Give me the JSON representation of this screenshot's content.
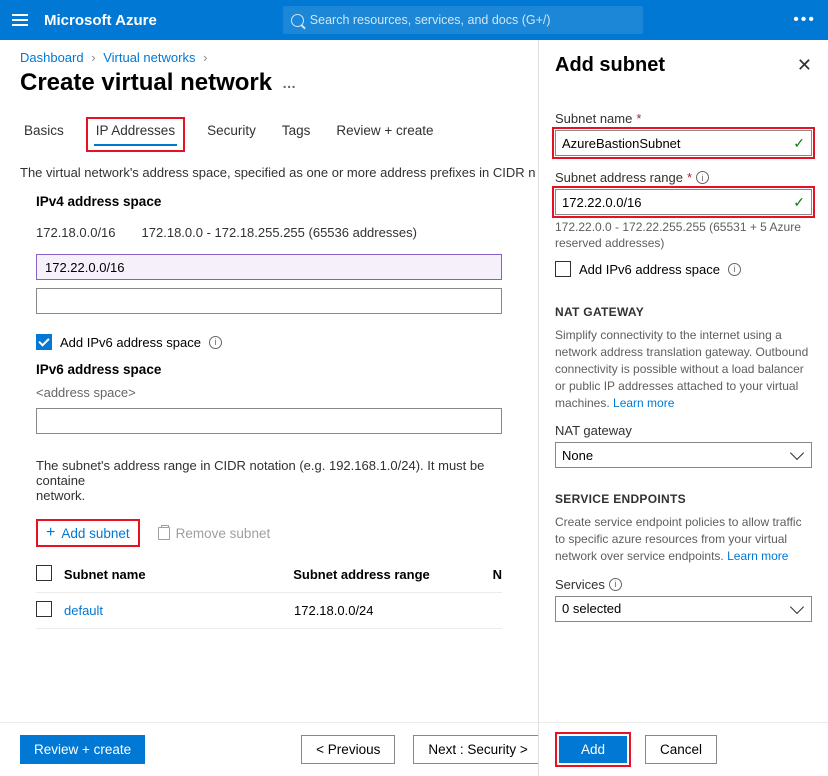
{
  "topbar": {
    "brand": "Microsoft Azure",
    "search_placeholder": "Search resources, services, and docs (G+/)"
  },
  "breadcrumbs": {
    "dashboard": "Dashboard",
    "vnets": "Virtual networks"
  },
  "page": {
    "title": "Create virtual network"
  },
  "tabs": {
    "basics": "Basics",
    "ip": "IP Addresses",
    "security": "Security",
    "tags": "Tags",
    "review": "Review + create"
  },
  "descriptions": {
    "ip_desc": "The virtual network's address space, specified as one or more address prefixes in CIDR n",
    "subnet_desc": "The subnet's address range in CIDR notation (e.g. 192.168.1.0/24). It must be containe",
    "subnet_desc2": "network."
  },
  "ipv4": {
    "header": "IPv4 address space",
    "existing_cidr": "172.18.0.0/16",
    "existing_range": "172.18.0.0 - 172.18.255.255 (65536 addresses)",
    "input_value": "172.22.0.0/16"
  },
  "ipv6": {
    "chk_label": "Add IPv6 address space",
    "header": "IPv6 address space",
    "placeholder": "<address space>"
  },
  "subnet_actions": {
    "add": "Add subnet",
    "remove": "Remove subnet"
  },
  "subnet_table": {
    "col_name": "Subnet name",
    "col_range": "Subnet address range",
    "col_n": "N",
    "row": {
      "name": "default",
      "range": "172.18.0.0/24"
    }
  },
  "footer": {
    "review": "Review + create",
    "prev": "< Previous",
    "next": "Next : Security >",
    "add": "Add",
    "cancel": "Cancel"
  },
  "panel": {
    "title": "Add subnet",
    "subnet_name_label": "Subnet name",
    "subnet_name_value": "AzureBastionSubnet",
    "range_label": "Subnet address range",
    "range_value": "172.22.0.0/16",
    "range_helper": "172.22.0.0 - 172.22.255.255 (65531 + 5 Azure reserved addresses)",
    "ipv6_chk": "Add IPv6 address space",
    "nat_header": "NAT GATEWAY",
    "nat_text": "Simplify connectivity to the internet using a network address translation gateway. Outbound connectivity is possible without a load balancer or public IP addresses attached to your virtual machines. ",
    "learn_more": "Learn more",
    "nat_label": "NAT gateway",
    "nat_value": "None",
    "se_header": "SERVICE ENDPOINTS",
    "se_text": "Create service endpoint policies to allow traffic to specific azure resources from your virtual network over service endpoints. ",
    "services_label": "Services",
    "services_value": "0 selected"
  }
}
